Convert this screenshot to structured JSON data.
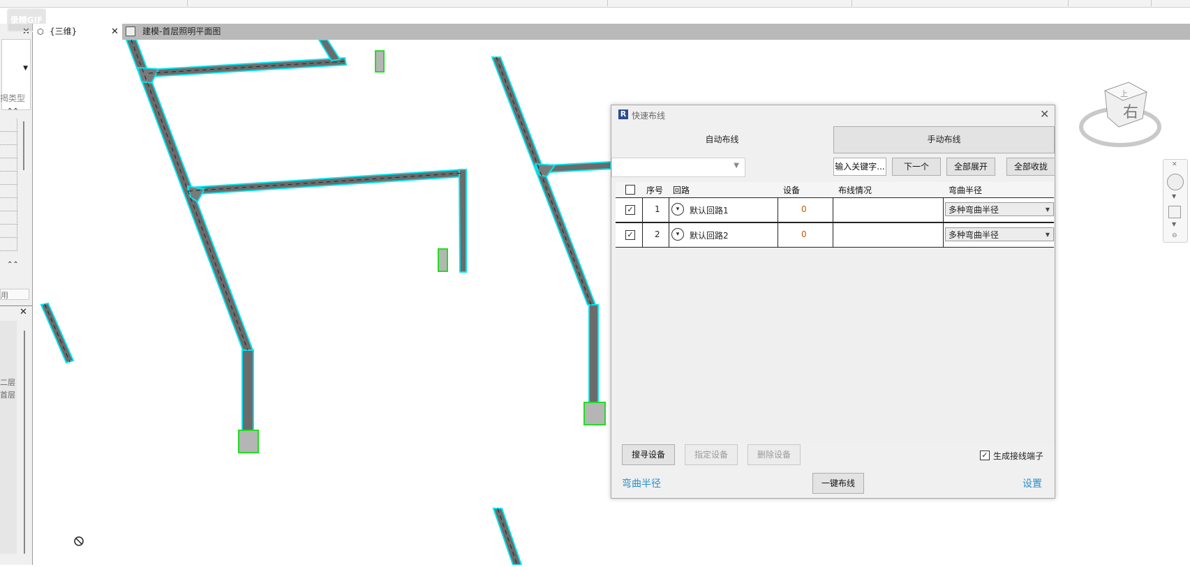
{
  "watermark": "录精GIF",
  "tabs": [
    {
      "label": "{三维}"
    },
    {
      "label": "建模-首层照明平面图"
    }
  ],
  "left_panel": {
    "label_type": "揭类型",
    "label_use": "用",
    "label_floor2": "二层",
    "label_floor1": "首层"
  },
  "view_cube": {
    "face": "右",
    "top_face": "上"
  },
  "dialog": {
    "title": "快速布线",
    "tab_auto": "自动布线",
    "tab_manual": "手动布线",
    "filter_value": "",
    "btn_keyword": "输入关键字...",
    "btn_next": "下一个",
    "btn_expand_all": "全部展开",
    "btn_collapse_all": "全部收拢",
    "columns": [
      "序号",
      "回路",
      "设备",
      "布线情况",
      "弯曲半径"
    ],
    "rows": [
      {
        "checked": true,
        "index": "1",
        "circuit": "默认回路1",
        "devices": "0",
        "status": "",
        "radius": "多种弯曲半径"
      },
      {
        "checked": true,
        "index": "2",
        "circuit": "默认回路2",
        "devices": "0",
        "status": "",
        "radius": "多种弯曲半径"
      }
    ],
    "btn_search": "搜寻设备",
    "btn_assign": "指定设备",
    "btn_delete": "删除设备",
    "gen_terminal_label": "生成接线端子",
    "gen_terminal_checked": true,
    "link_bend_radius": "弯曲半径",
    "btn_one_key": "一键布线",
    "link_settings": "设置"
  },
  "colors": {
    "selection_outline": "#00e5ee",
    "device_highlight": "#22dd22",
    "link": "#2a8fc9"
  }
}
